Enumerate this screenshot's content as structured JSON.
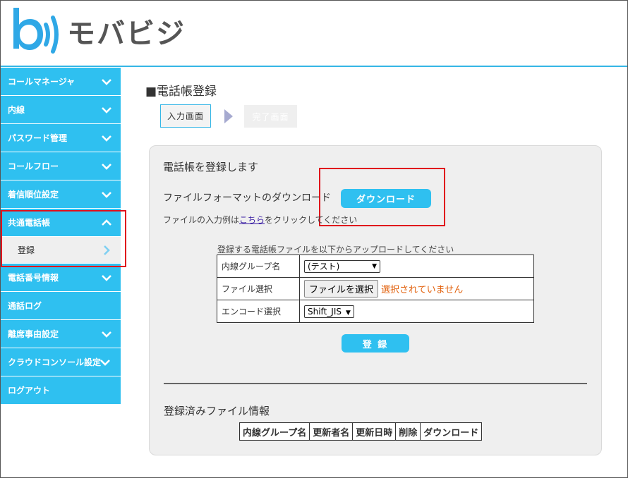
{
  "brand": {
    "name": "モバビジ",
    "accent": "#2fc0f0",
    "alert_color": "#e0101c"
  },
  "sidebar": {
    "items": [
      {
        "label": "コールマネージャ",
        "icon": "chevron-down-icon"
      },
      {
        "label": "内線",
        "icon": "chevron-down-icon"
      },
      {
        "label": "パスワード管理",
        "icon": "chevron-down-icon"
      },
      {
        "label": "コールフロー",
        "icon": "chevron-down-icon"
      },
      {
        "label": "着信順位設定",
        "icon": "chevron-down-icon"
      },
      {
        "label": "共通電話帳",
        "icon": "chevron-up-icon",
        "expanded": true,
        "children": [
          {
            "label": "登録",
            "icon": "chevron-right-icon"
          }
        ]
      },
      {
        "label": "電話番号情報",
        "icon": "chevron-down-icon"
      },
      {
        "label": "通話ログ"
      },
      {
        "label": "離席事由設定",
        "icon": "chevron-down-icon"
      },
      {
        "label": "クラウドコンソール設定",
        "icon": "chevron-down-icon"
      },
      {
        "label": "ログアウト"
      }
    ]
  },
  "main": {
    "title": "■電話帳登録",
    "steps": [
      "入力画面",
      "完了画面"
    ],
    "panel": {
      "heading": "電話帳を登録します",
      "format_label": "ファイルフォーマットのダウンロード",
      "download_button": "ダウンロード",
      "example_prefix": "ファイルの入力例は",
      "example_link": "こちら",
      "example_suffix": "をクリックしてください",
      "upload_caption": "登録する電話帳ファイルを以下からアップロードしてください",
      "rows": [
        {
          "label": "内線グループ名",
          "value": "(テスト)"
        },
        {
          "label": "ファイル選択",
          "button": "ファイルを選択",
          "status": "選択されていません"
        },
        {
          "label": "エンコード選択",
          "value": "Shift_JIS"
        }
      ],
      "register_button": "登 録",
      "files_heading": "登録済みファイル情報",
      "files_columns": [
        "内線グループ名",
        "更新者名",
        "更新日時",
        "削除",
        "ダウンロード"
      ]
    }
  }
}
